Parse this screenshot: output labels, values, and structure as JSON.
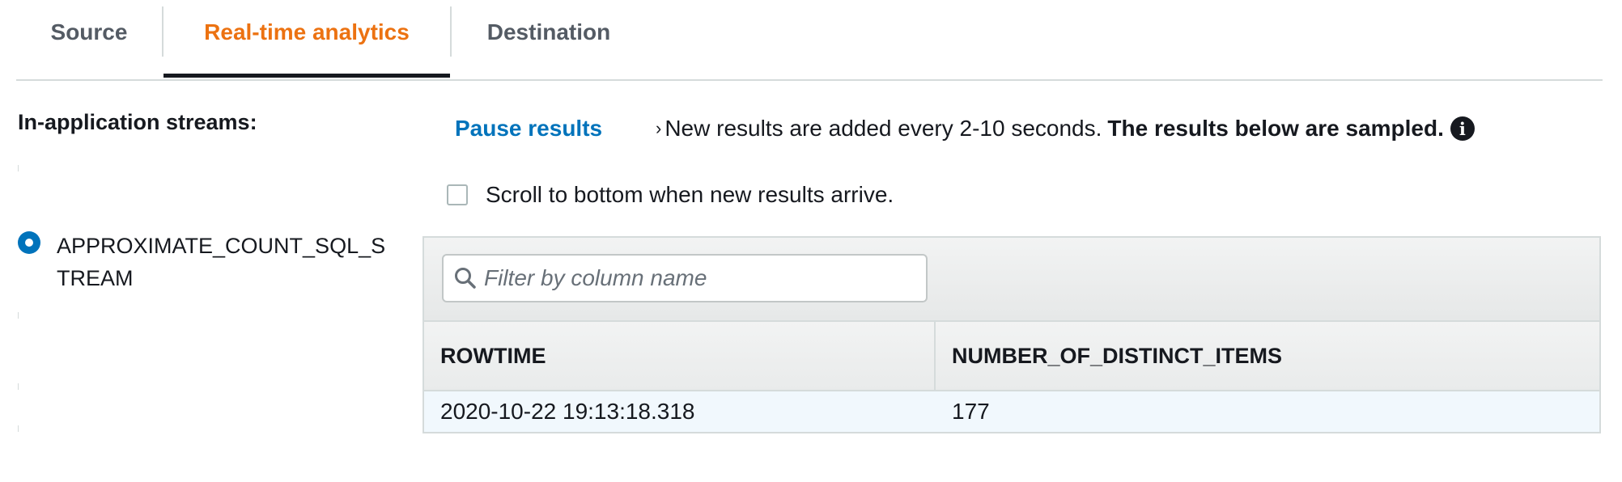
{
  "tabs": [
    {
      "label": "Source",
      "active": false
    },
    {
      "label": "Real-time analytics",
      "active": true
    },
    {
      "label": "Destination",
      "active": false
    }
  ],
  "colors": {
    "active_tab": "#ec7211",
    "link": "#0073bb",
    "selected_radio": "#0073bb",
    "row_highlight": "#f1f8fd"
  },
  "streams": {
    "heading": "In-application streams:",
    "items": [
      {
        "label": "APPROXIMATE_COUNT_SQL_STREAM",
        "selected": true
      }
    ]
  },
  "results": {
    "pause_label": "Pause results",
    "info_text": "New results are added every 2-10 seconds.",
    "sampled_text": "The results below are sampled.",
    "info_icon": "info-icon",
    "scroll_label": "Scroll to bottom when new results arrive.",
    "scroll_checked": false,
    "filter_placeholder": "Filter by column name",
    "filter_icon": "search-icon",
    "columns": [
      "ROWTIME",
      "NUMBER_OF_DISTINCT_ITEMS"
    ],
    "rows": [
      [
        "2020-10-22 19:13:18.318",
        "177"
      ]
    ]
  }
}
